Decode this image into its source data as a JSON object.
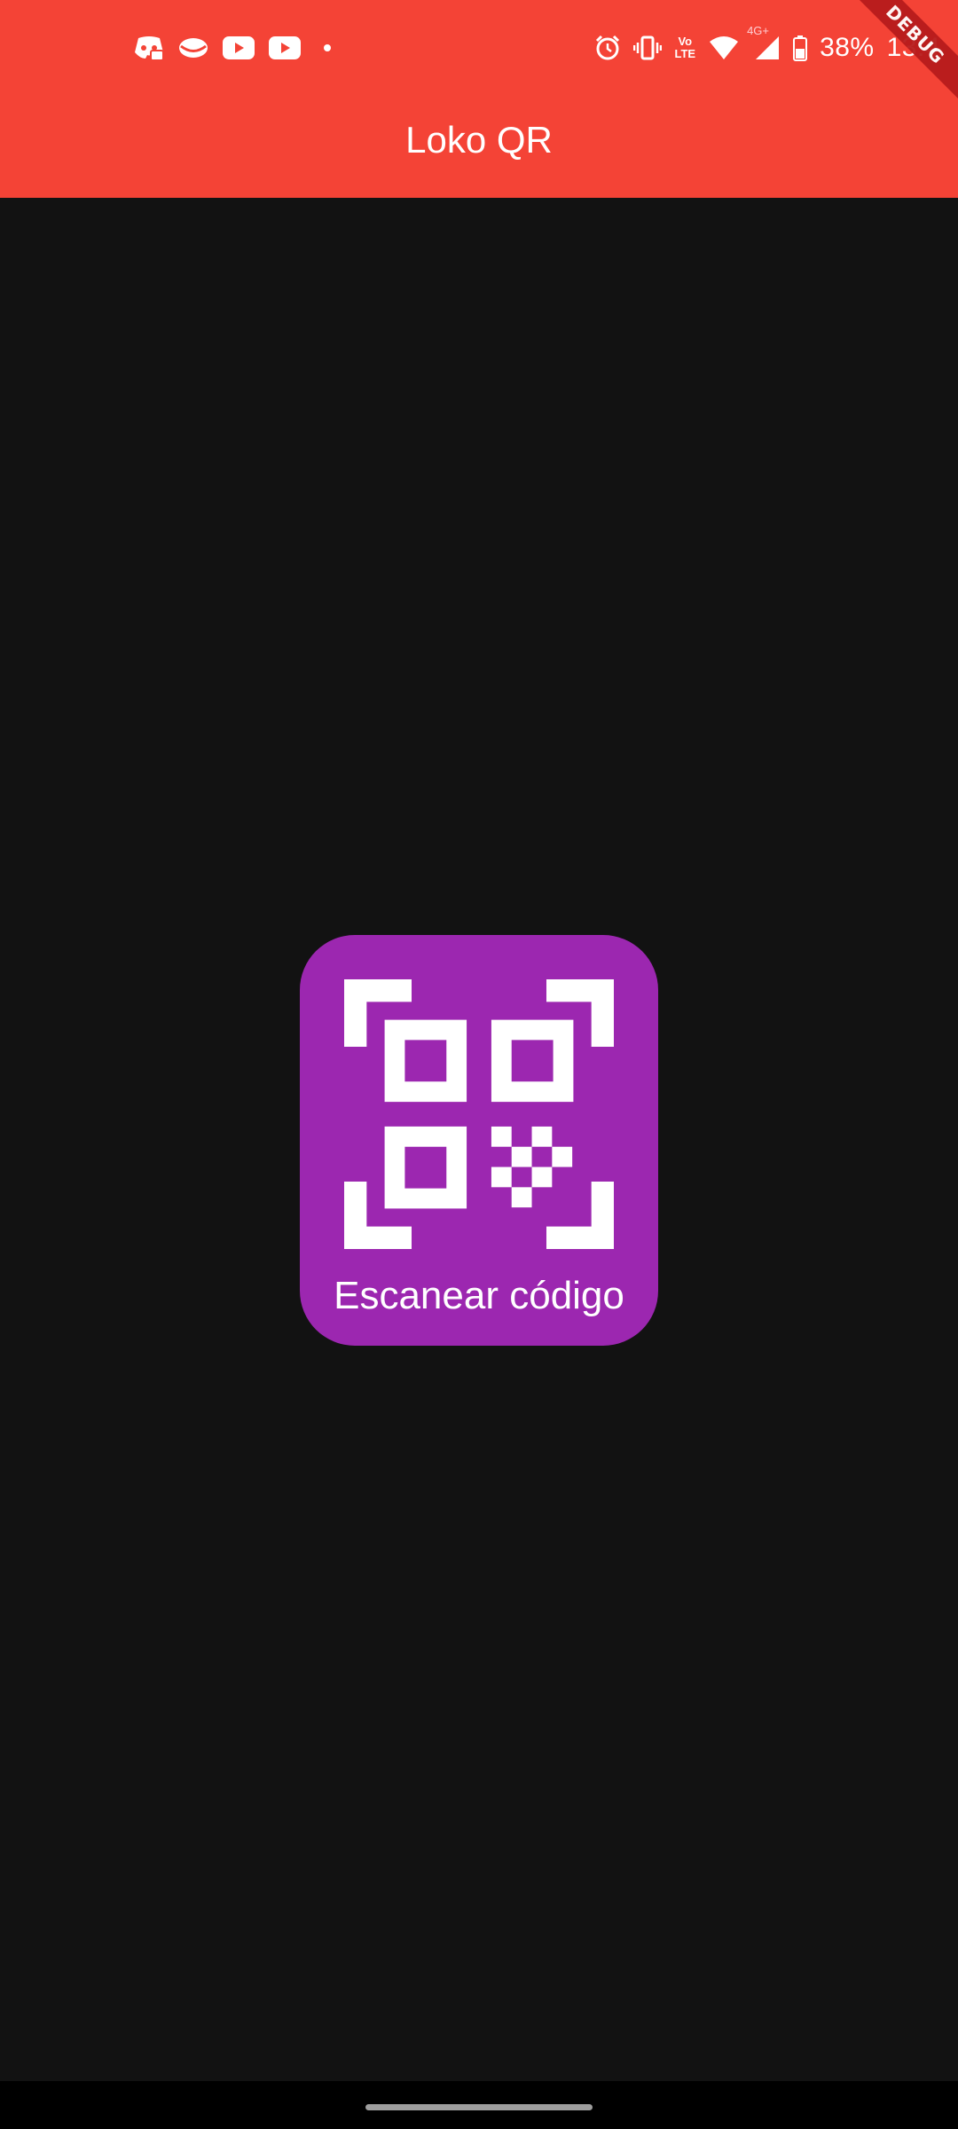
{
  "status_bar": {
    "battery_percent": "38%",
    "time": "13:4",
    "network_label": "4G+",
    "volte_label_top": "Vo",
    "volte_label_bottom": "LTE",
    "left_icons": [
      "discord-icon",
      "pinterest-lens-icon",
      "youtube-icon",
      "youtube-icon",
      "dot-icon"
    ],
    "right_icons": [
      "alarm-icon",
      "vibrate-icon",
      "volte-icon",
      "wifi-icon",
      "cell-signal-icon",
      "battery-icon"
    ]
  },
  "app_bar": {
    "title": "Loko QR",
    "color": "#f44336"
  },
  "debug_banner": {
    "label": "DEBUG"
  },
  "scan_button": {
    "label": "Escanear código",
    "icon": "qr-code-scanner-icon",
    "color": "#9c27b0"
  },
  "theme": {
    "background": "#121212"
  }
}
